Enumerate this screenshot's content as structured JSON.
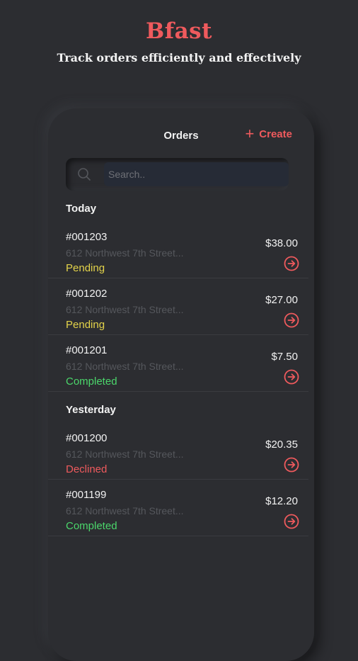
{
  "app": {
    "brand": "Bfast",
    "tagline": "Track orders efficiently and effectively"
  },
  "screen": {
    "title": "Orders",
    "create_label": "Create",
    "search_placeholder": "Search.."
  },
  "sections": [
    {
      "label": "Today",
      "orders": [
        {
          "id": "#001203",
          "address": "612 Northwest 7th Street...",
          "status": "Pending",
          "price": "$38.00"
        },
        {
          "id": "#001202",
          "address": "612 Northwest 7th Street...",
          "status": "Pending",
          "price": "$27.00"
        },
        {
          "id": "#001201",
          "address": "612 Northwest 7th Street...",
          "status": "Completed",
          "price": "$7.50"
        }
      ]
    },
    {
      "label": "Yesterday",
      "orders": [
        {
          "id": "#001200",
          "address": "612 Northwest 7th Street...",
          "status": "Declined",
          "price": "$20.35"
        },
        {
          "id": "#001199",
          "address": "612 Northwest 7th Street...",
          "status": "Completed",
          "price": "$12.20"
        }
      ]
    }
  ],
  "colors": {
    "background": "#2c2d31",
    "accent": "#ef5a5d",
    "pending": "#e3d34a",
    "completed": "#4bd66b",
    "declined": "#ef5a5d"
  },
  "icons": {
    "search": "search-icon",
    "create": "plus-icon",
    "open_order": "arrow-right-circle-icon"
  }
}
